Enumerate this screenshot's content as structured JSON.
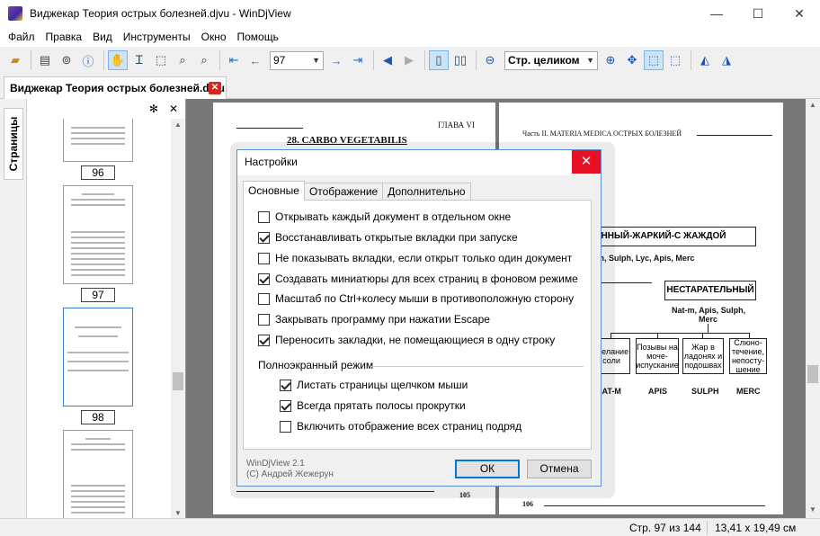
{
  "window": {
    "title": "Виджекар Теория острых болезней.djvu - WinDjView"
  },
  "menu": [
    "Файл",
    "Правка",
    "Вид",
    "Инструменты",
    "Окно",
    "Помощь"
  ],
  "toolbar": {
    "page_value": "97",
    "zoom_value": "Стр. целиком"
  },
  "tab": {
    "title": "Виджекар Теория острых болезней.djvu"
  },
  "sidebar": {
    "tab_label": "Страницы",
    "thumbs": [
      "96",
      "97",
      "98"
    ]
  },
  "page_left": {
    "header": "ГЛАВА VI",
    "title": "28. CARBO VEGETABILIS",
    "page_number": "105"
  },
  "page_right": {
    "header": "Часть II. MATERIA MEDICA ОСТРЫХ БОЛЕЗНЕЙ",
    "box_top": "ННЫЙ-ЖАРКИЙ-С ЖАЖДОЙ",
    "remedies_top": "at-m, Sulph, Lyc, Apis, Merc",
    "box_mid": "НЕСТАРАТЕЛЬНЫЙ",
    "remedies_mid1": "Nat-m, Apis, Sulph,",
    "remedies_mid2": "Merc",
    "leaves": [
      "Желание соли",
      "Позывы на моче-испускание",
      "Жар в ладонях и подошвах",
      "Слюно-течение, непосту-шение"
    ],
    "leaf_labels": [
      "NAT-M",
      "APIS",
      "SULPH",
      "MERC"
    ],
    "page_number": "106"
  },
  "dialog": {
    "title": "Настройки",
    "tabs": [
      "Основные",
      "Отображение",
      "Дополнительно"
    ],
    "options": [
      {
        "label": "Открывать каждый документ в отдельном окне",
        "checked": false
      },
      {
        "label": "Восстанавливать открытые вкладки при запуске",
        "checked": true
      },
      {
        "label": "Не показывать вкладки, если открыт только один документ",
        "checked": false
      },
      {
        "label": "Создавать миниатюры для всех страниц в фоновом режиме",
        "checked": true
      },
      {
        "label": "Масштаб по Ctrl+колесу мыши в противоположную сторону",
        "checked": false
      },
      {
        "label": "Закрывать программу при нажатии Escape",
        "checked": false
      },
      {
        "label": "Переносить закладки, не помещающиеся в одну строку",
        "checked": true
      }
    ],
    "fullscreen_group": "Полноэкранный режим",
    "fullscreen_options": [
      {
        "label": "Листать страницы щелчком мыши",
        "checked": true
      },
      {
        "label": "Всегда прятать полосы прокрутки",
        "checked": true
      },
      {
        "label": "Включить отображение всех страниц подряд",
        "checked": false
      }
    ],
    "version": "WinDjView 2.1",
    "copyright": "(С) Андрей Жежерун",
    "ok": "ОК",
    "cancel": "Отмена"
  },
  "status": {
    "page": "Стр. 97 из 144",
    "size": "13,41 x 19,49 см"
  }
}
